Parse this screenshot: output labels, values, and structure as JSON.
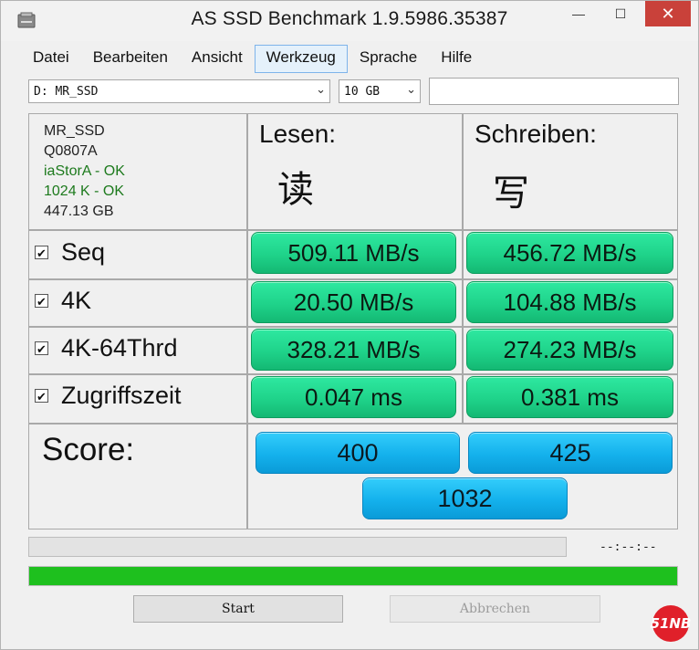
{
  "window": {
    "title": "AS SSD Benchmark 1.9.5986.35387"
  },
  "menu": [
    "Datei",
    "Bearbeiten",
    "Ansicht",
    "Werkzeug",
    "Sprache",
    "Hilfe"
  ],
  "drive_select": {
    "value": "D: MR_SSD"
  },
  "size_select": {
    "value": "10 GB"
  },
  "drive_info": {
    "name": "MR_SSD",
    "firmware": "Q0807A",
    "driver": "iaStorA - OK",
    "alignment": "1024 K - OK",
    "capacity": "447.13 GB"
  },
  "headers": {
    "read": "Lesen:",
    "read_glyph": "读",
    "write": "Schreiben:",
    "write_glyph": "写"
  },
  "rows": [
    {
      "label": "Seq",
      "checked": true,
      "read": "509.11 MB/s",
      "write": "456.72 MB/s"
    },
    {
      "label": "4K",
      "checked": true,
      "read": "20.50 MB/s",
      "write": "104.88 MB/s"
    },
    {
      "label": "4K-64Thrd",
      "checked": true,
      "read": "328.21 MB/s",
      "write": "274.23 MB/s"
    },
    {
      "label": "Zugriffszeit",
      "checked": true,
      "read": "0.047 ms",
      "write": "0.381 ms"
    }
  ],
  "score": {
    "label": "Score:",
    "read": "400",
    "write": "425",
    "total": "1032"
  },
  "status": {
    "time": "--:--:--",
    "test_progress": 0,
    "overall_progress": 1.0
  },
  "buttons": {
    "start": "Start",
    "abort": "Abbrechen"
  },
  "watermark": "51NB",
  "colors": {
    "result_green": "#1fd38a",
    "score_blue": "#14b1ec",
    "progress_green": "#1ec01e",
    "ok_text": "#1d7a1d",
    "close_red": "#c9413a"
  }
}
